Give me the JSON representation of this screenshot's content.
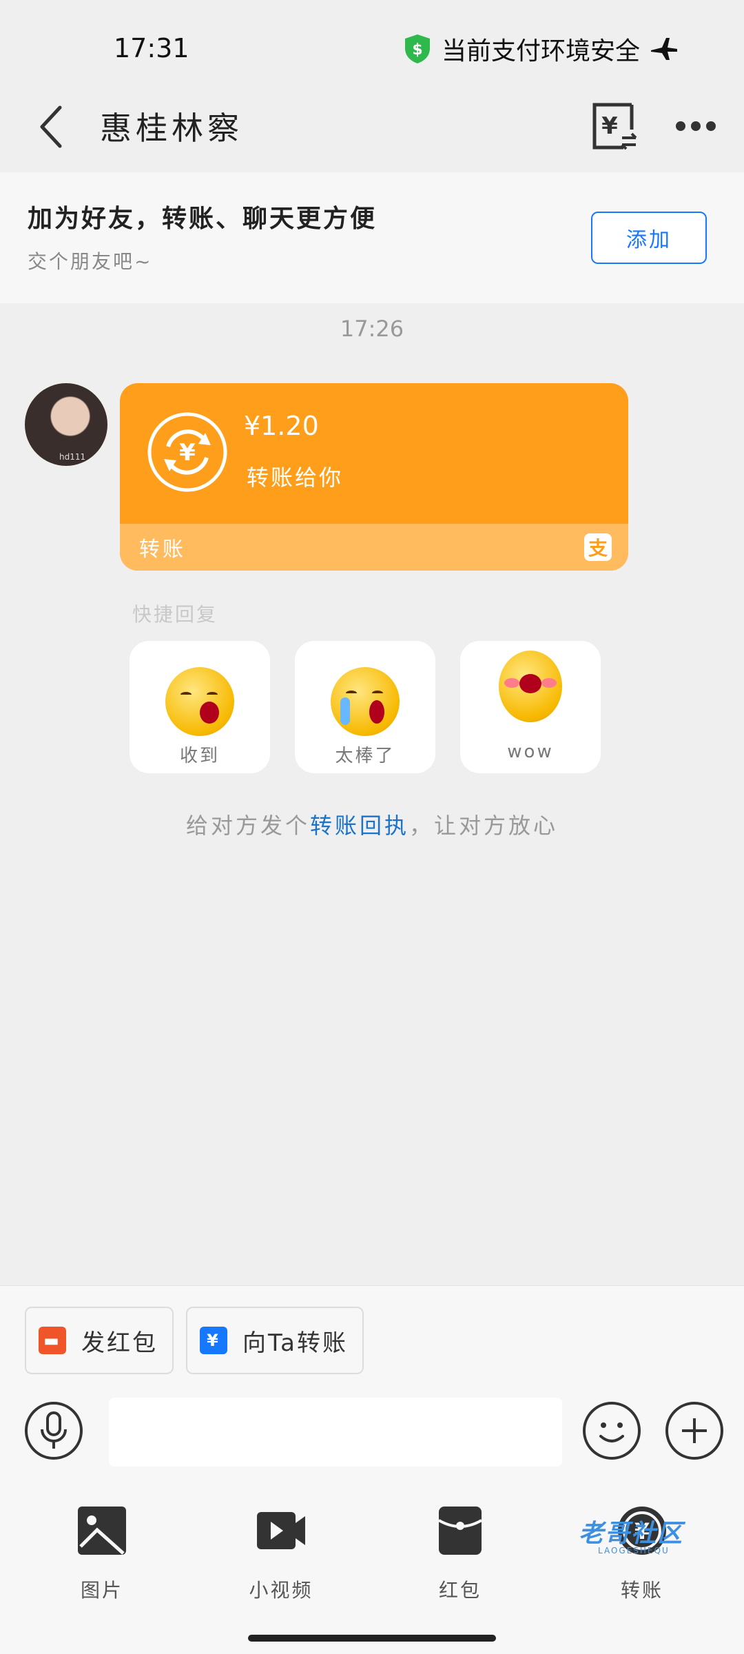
{
  "status_bar": {
    "time": "17:31",
    "security_text": "当前支付环境安全",
    "shield_color": "#2fb94c"
  },
  "nav": {
    "title": "惠桂林察",
    "icons": [
      "back-icon",
      "bill-icon",
      "more-icon"
    ]
  },
  "banner": {
    "title": "加为好友，转账、聊天更方便",
    "subtitle": "交个朋友吧~",
    "add_label": "添加",
    "add_color": "#1677ff"
  },
  "chat": {
    "time": "17:26",
    "avatar_caption": "hd111",
    "transfer": {
      "amount": "¥1.20",
      "description": "转账给你",
      "label": "转账",
      "brand_icon_glyph": "支",
      "card_color": "#ff9e1b"
    },
    "quick_reply_label": "快捷回复",
    "quick_replies": [
      {
        "label": "收到"
      },
      {
        "label": "太棒了"
      },
      {
        "label": "wow"
      }
    ],
    "receipt_tip_before": "给对方发个",
    "receipt_tip_link": "转账回执",
    "receipt_tip_after": "，让对方放心"
  },
  "shortcuts": [
    {
      "label": "发红包",
      "color": "#f0552a",
      "icon": "red-packet-icon"
    },
    {
      "label": "向Ta转账",
      "color": "#1677ff",
      "icon": "transfer-icon"
    }
  ],
  "input": {
    "value": "",
    "placeholder": ""
  },
  "tools": [
    {
      "label": "图片",
      "icon": "image-icon"
    },
    {
      "label": "小视频",
      "icon": "video-icon"
    },
    {
      "label": "红包",
      "icon": "red-packet-icon"
    },
    {
      "label": "转账",
      "icon": "transfer-icon"
    }
  ],
  "watermark": {
    "text": "老哥社区",
    "sub": "LAOGESHEQU"
  }
}
